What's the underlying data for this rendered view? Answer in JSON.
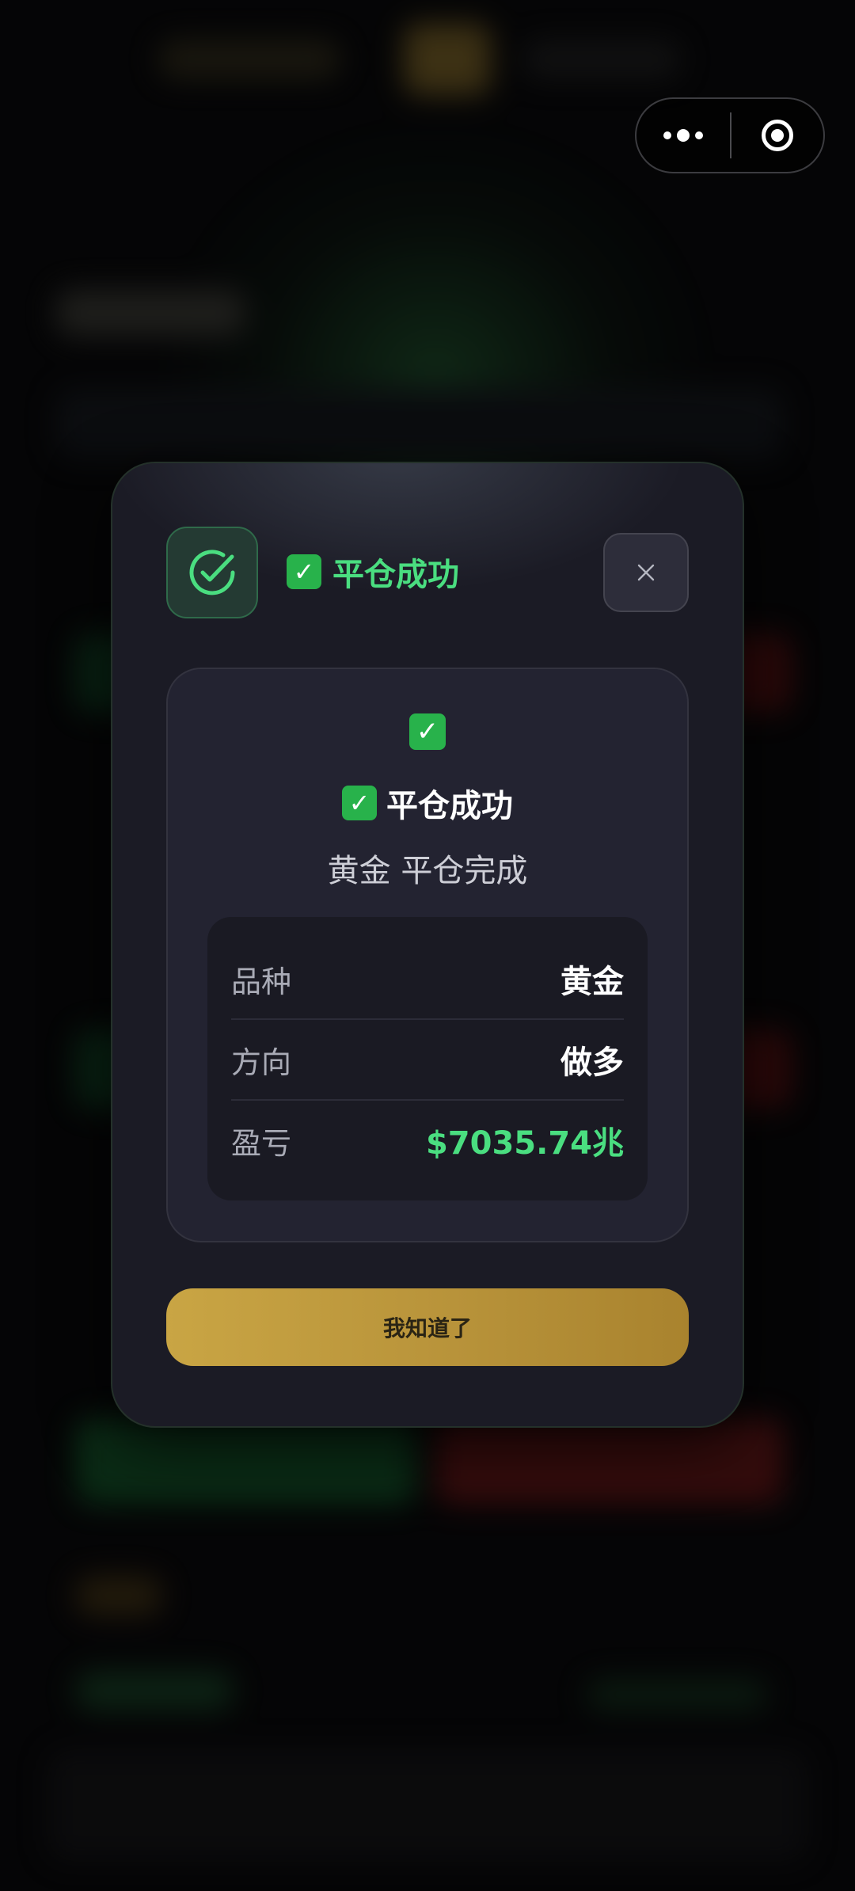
{
  "capsule": {
    "more_icon": "more-dots-icon",
    "close_icon": "target-circle-icon"
  },
  "modal": {
    "status_icon": "check-circle-icon",
    "title": "平仓成功",
    "close_icon": "close-x-icon",
    "result": {
      "emoji": "✅",
      "title": "平仓成功",
      "subtitle": "黄金 平仓完成",
      "details": [
        {
          "label": "品种",
          "value": "黄金"
        },
        {
          "label": "方向",
          "value": "做多"
        },
        {
          "label": "盈亏",
          "value": "$7035.74兆"
        }
      ]
    },
    "confirm_label": "我知道了"
  },
  "colors": {
    "success": "#4ade80",
    "accent_gold": "#c9a544",
    "modal_bg": "#1b1b25"
  }
}
